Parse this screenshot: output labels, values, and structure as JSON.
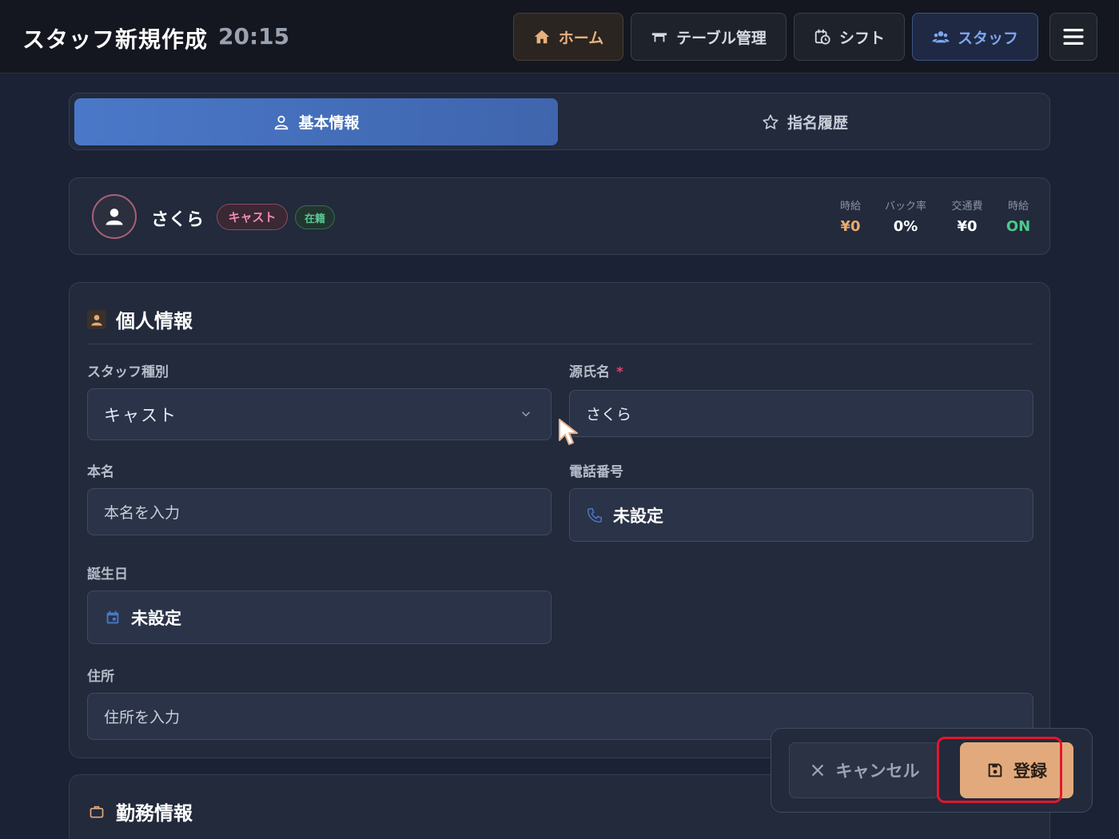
{
  "header": {
    "title": "スタッフ新規作成",
    "time": "20:15",
    "nav": [
      {
        "label": "ホーム",
        "icon": "home-icon"
      },
      {
        "label": "テーブル管理",
        "icon": "table-icon"
      },
      {
        "label": "シフト",
        "icon": "calendar-clock-icon"
      },
      {
        "label": "スタッフ",
        "icon": "users-icon"
      }
    ],
    "menu_icon": "hamburger-menu-icon",
    "active_nav": "スタッフ"
  },
  "tabs": [
    {
      "label": "基本情報",
      "icon": "user-icon",
      "active": true
    },
    {
      "label": "指名履歴",
      "icon": "star-icon",
      "active": false
    }
  ],
  "summary": {
    "name": "さくら",
    "role_badge": "キャスト",
    "status_badge": "在籍",
    "stats": [
      {
        "label": "時給",
        "value": "¥0"
      },
      {
        "label": "バック率",
        "value": "0%"
      },
      {
        "label": "交通費",
        "value": "¥0"
      },
      {
        "label": "時給",
        "value": "ON"
      }
    ]
  },
  "personal": {
    "section_title": "個人情報",
    "staff_type": {
      "label": "スタッフ種別",
      "value": "キャスト"
    },
    "stage_name": {
      "label": "源氏名",
      "required_mark": "*",
      "value": "さくら"
    },
    "real_name": {
      "label": "本名",
      "placeholder": "本名を入力"
    },
    "phone": {
      "label": "電話番号",
      "value": "未設定"
    },
    "birthday": {
      "label": "誕生日",
      "value": "未設定"
    },
    "address": {
      "label": "住所",
      "placeholder": "住所を入力"
    }
  },
  "work": {
    "section_title": "勤務情報"
  },
  "actions": {
    "cancel_label": "キャンセル",
    "save_label": "登録"
  },
  "colors": {
    "background": "#1b2235",
    "accent_blue": "#4a78c8",
    "accent_orange": "#e2aa7c",
    "status_green": "#4cc98a",
    "highlight_red": "#e1182d"
  }
}
